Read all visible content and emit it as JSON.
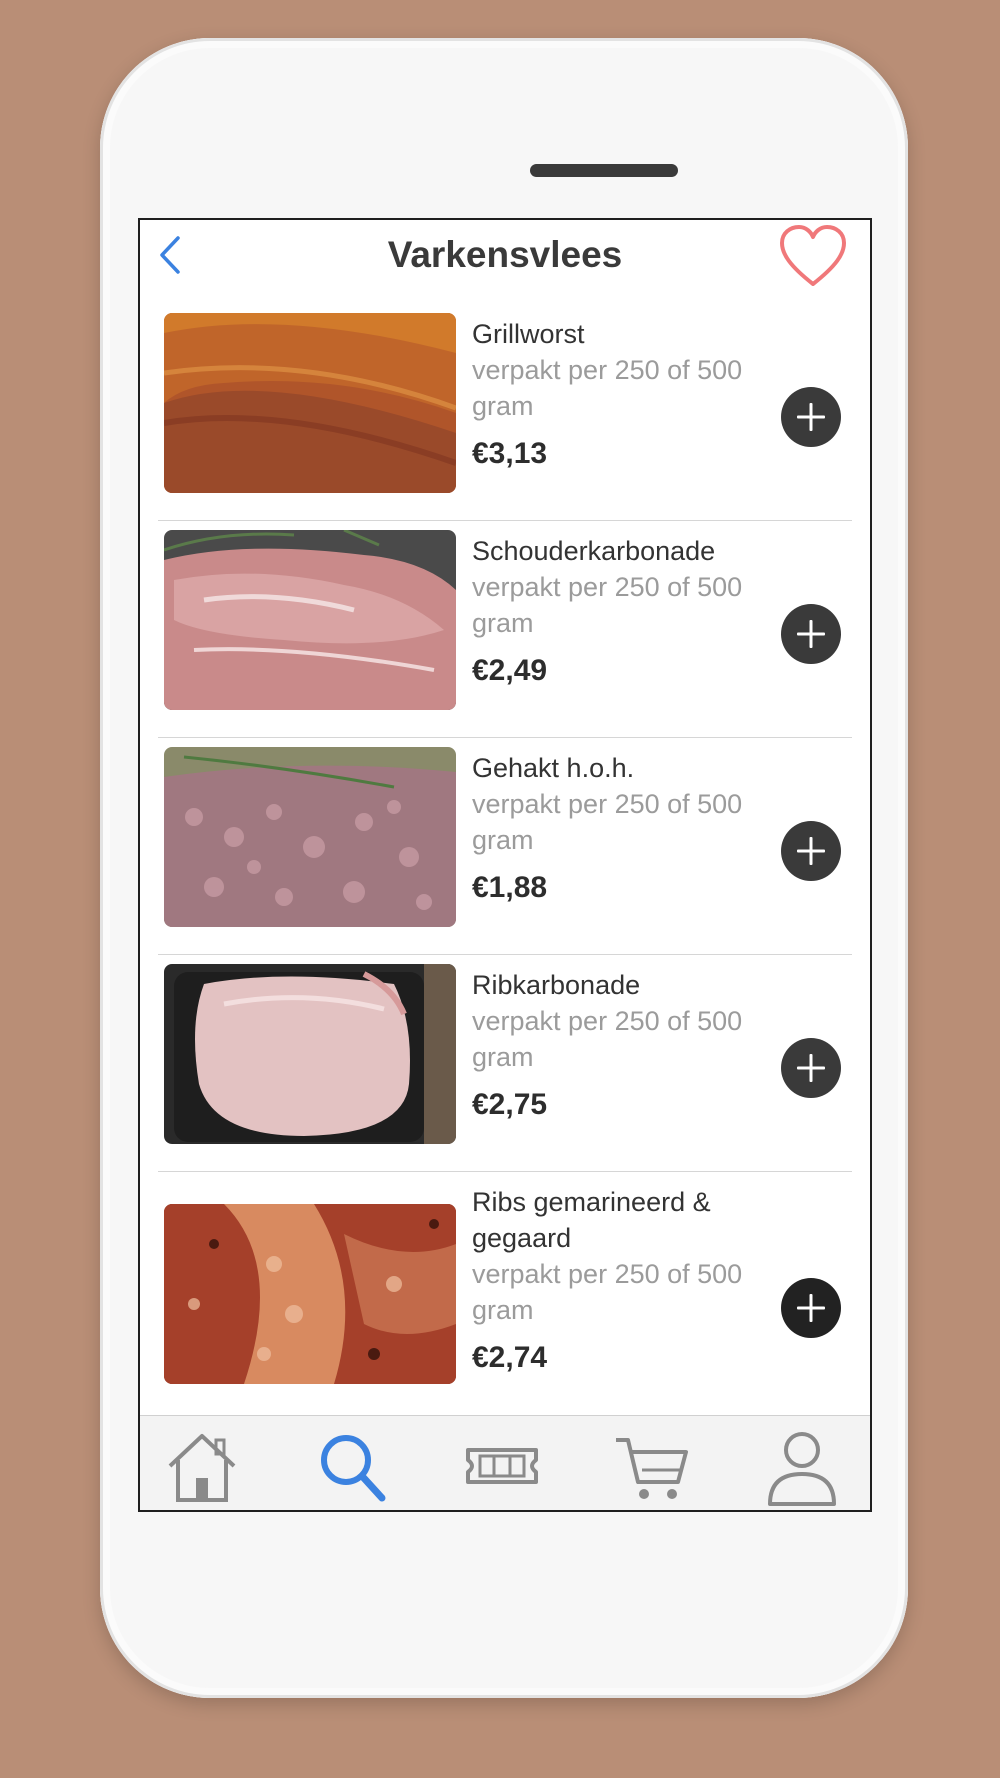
{
  "header": {
    "title": "Varkensvlees",
    "back_icon": "chevron-left-icon",
    "favorite_icon": "heart-icon"
  },
  "colors": {
    "accent": "#3b82e0",
    "heart": "#f0787a",
    "background": "#b98e76",
    "add_button": "#3a3a3a"
  },
  "products": [
    {
      "name": "Grillworst",
      "desc": "verpakt per 250 of 500 gram",
      "price": "€3,13"
    },
    {
      "name": "Schouderkarbonade",
      "desc": "verpakt per 250 of 500 gram",
      "price": "€2,49"
    },
    {
      "name": "Gehakt h.o.h.",
      "desc": "verpakt per 250 of 500 gram",
      "price": "€1,88"
    },
    {
      "name": "Ribkarbonade",
      "desc": "verpakt per 250 of 500 gram",
      "price": "€2,75"
    },
    {
      "name": "Ribs gemarineerd & gegaard",
      "desc": "verpakt per 250 of 500 gram",
      "price": "€2,74"
    }
  ],
  "tabbar": {
    "active": "search",
    "tabs": [
      {
        "id": "home",
        "icon": "home-icon"
      },
      {
        "id": "search",
        "icon": "search-icon"
      },
      {
        "id": "offers",
        "icon": "ticket-icon"
      },
      {
        "id": "cart",
        "icon": "cart-icon"
      },
      {
        "id": "profile",
        "icon": "user-icon"
      }
    ]
  }
}
